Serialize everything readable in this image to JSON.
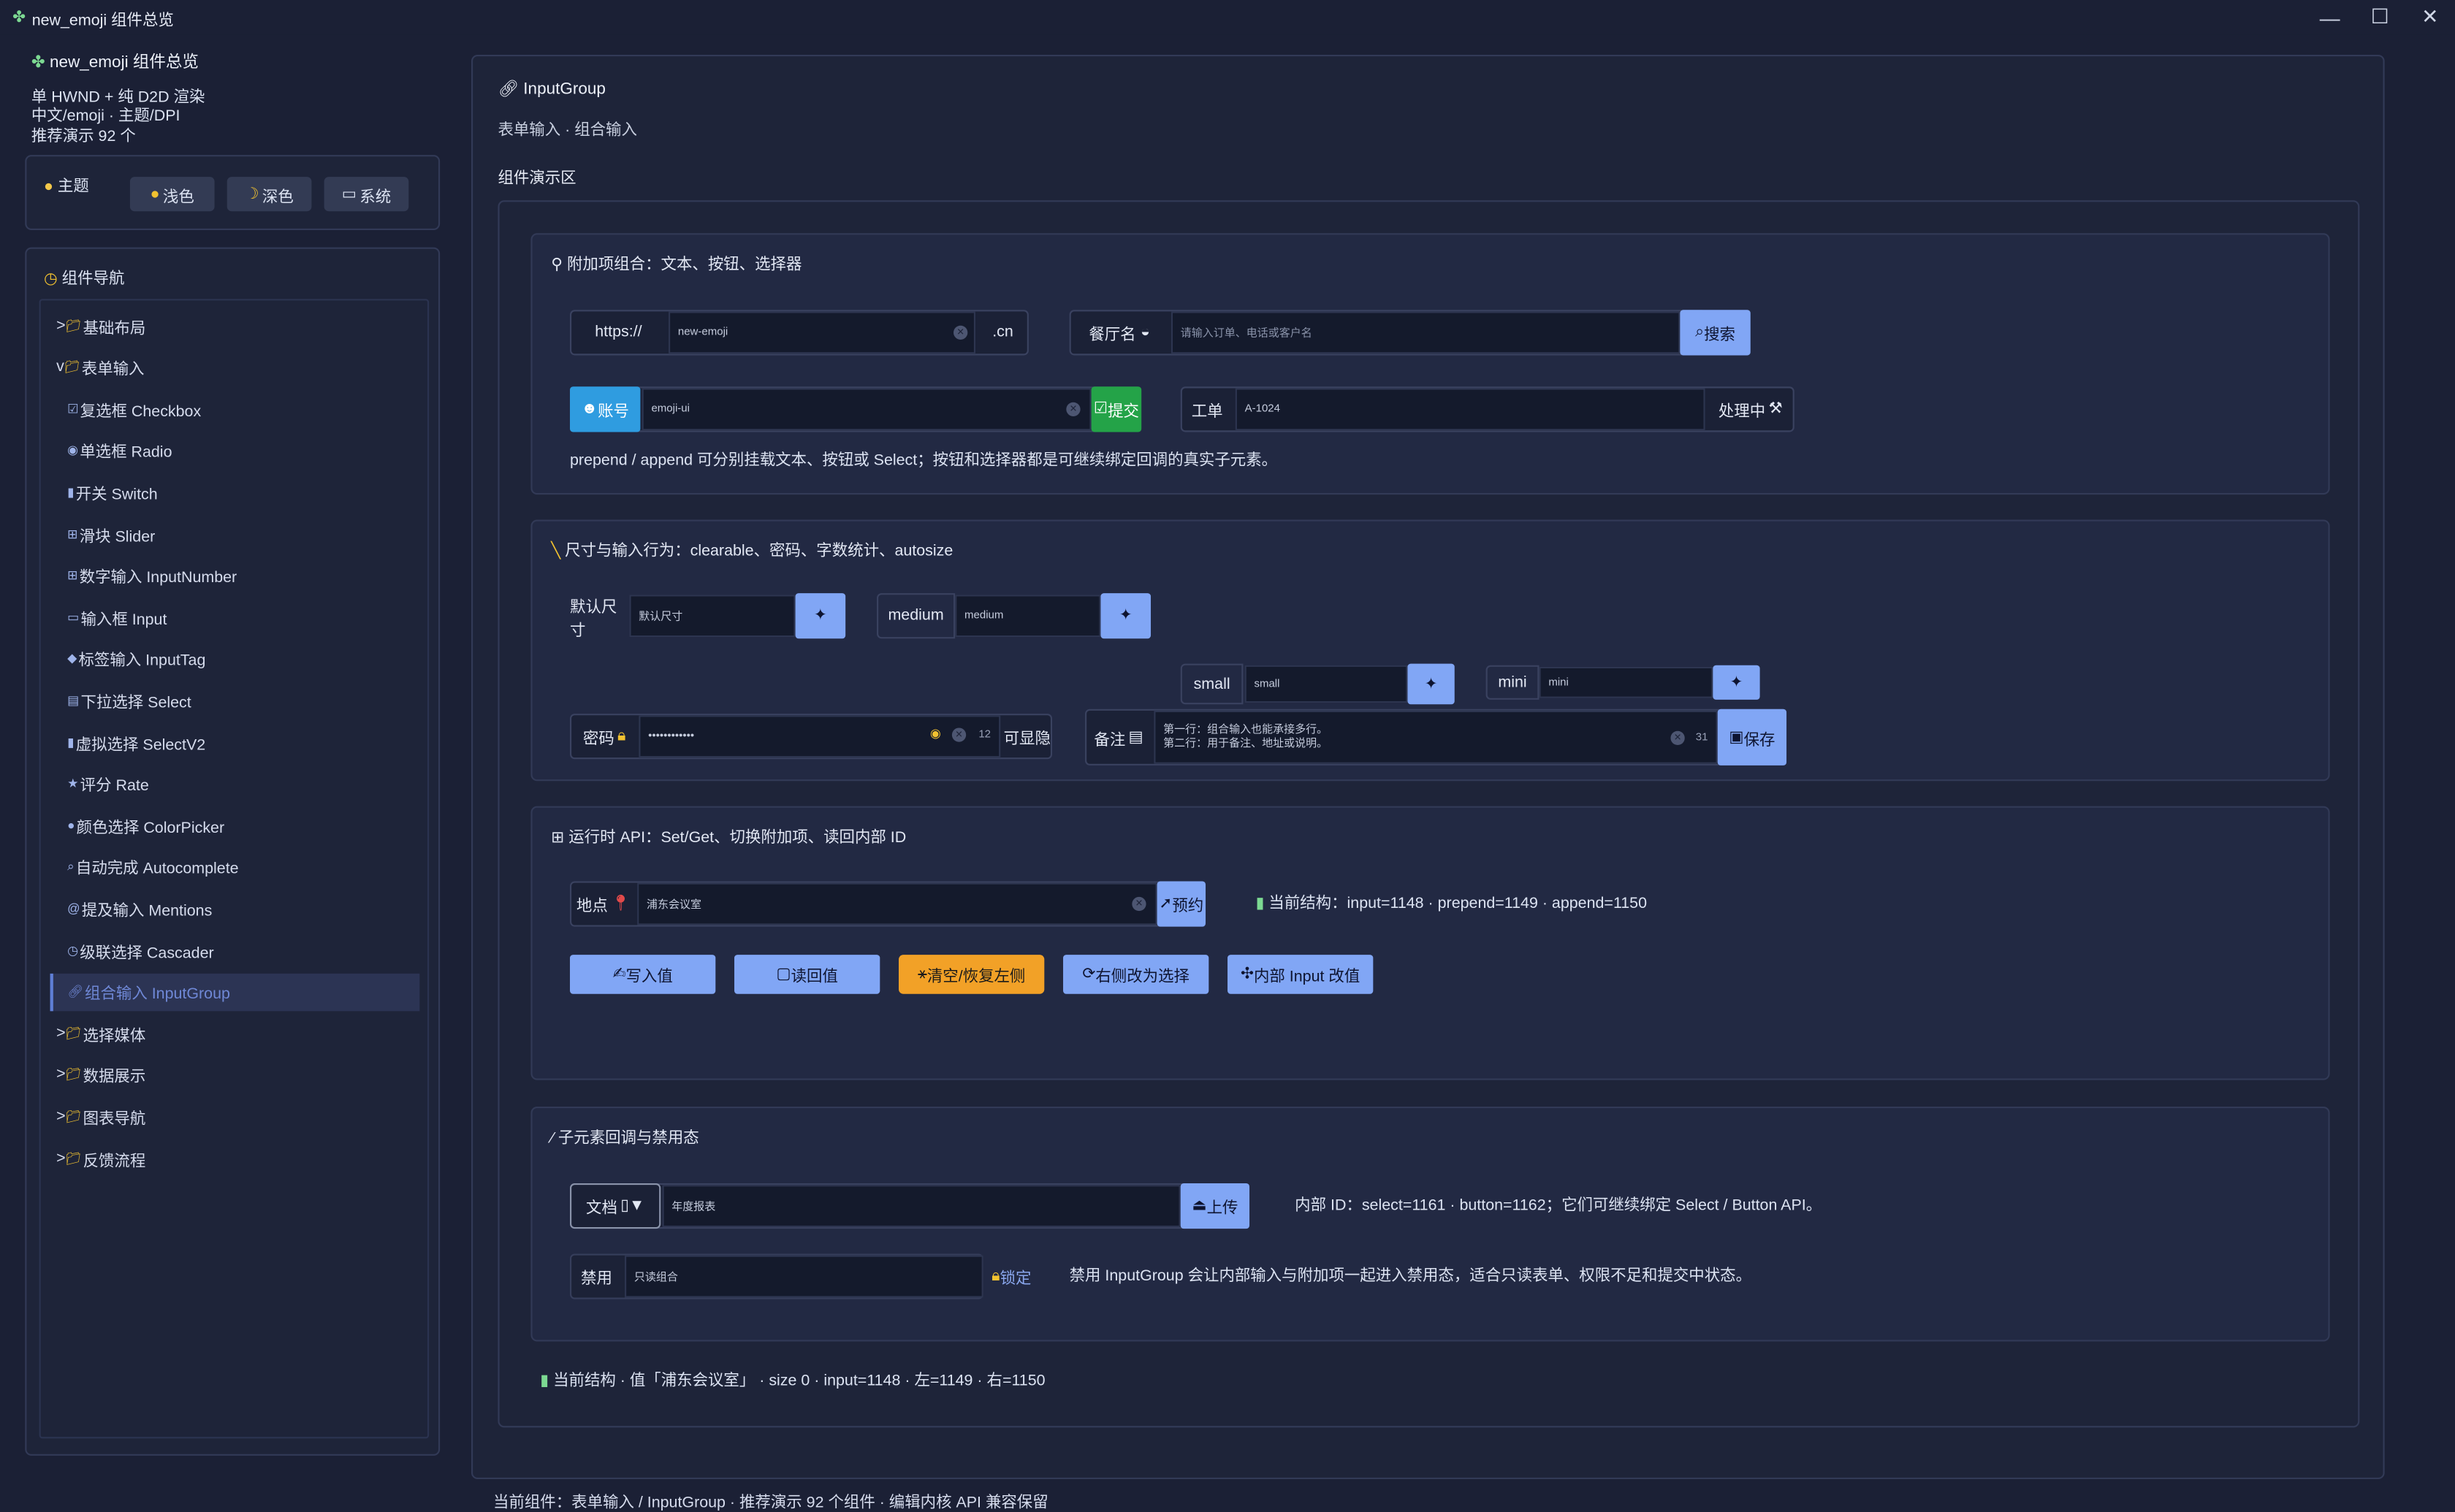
{
  "window": {
    "title": "new_emoji 组件总览",
    "icon": "✤",
    "min": "—",
    "max": "☐",
    "close": "✕"
  },
  "sidebar": {
    "title": "new_emoji 组件总览",
    "lines": [
      "单 HWND + 纯 D2D 渲染",
      "中文/emoji · 主题/DPI",
      "推荐演示 92 个"
    ],
    "theme": {
      "label": "主题",
      "buttons": [
        "浅色",
        "深色",
        "系统"
      ]
    },
    "nav": {
      "label": "组件导航",
      "items": [
        {
          "label": "基础布局",
          "prefix": ">"
        },
        {
          "label": "表单输入",
          "prefix": "v"
        },
        {
          "label": "复选框 Checkbox"
        },
        {
          "label": "单选框 Radio"
        },
        {
          "label": "开关 Switch"
        },
        {
          "label": "滑块 Slider"
        },
        {
          "label": "数字输入 InputNumber"
        },
        {
          "label": "输入框 Input"
        },
        {
          "label": "标签输入 InputTag"
        },
        {
          "label": "下拉选择 Select"
        },
        {
          "label": "虚拟选择 SelectV2"
        },
        {
          "label": "评分 Rate"
        },
        {
          "label": "颜色选择 ColorPicker"
        },
        {
          "label": "自动完成 Autocomplete"
        },
        {
          "label": "提及输入 Mentions"
        },
        {
          "label": "级联选择 Cascader"
        },
        {
          "label": "组合输入 InputGroup"
        },
        {
          "label": "选择媒体",
          "prefix": ">"
        },
        {
          "label": "数据展示",
          "prefix": ">"
        },
        {
          "label": "图表导航",
          "prefix": ">"
        },
        {
          "label": "反馈流程",
          "prefix": ">"
        }
      ]
    }
  },
  "main": {
    "title": "InputGroup",
    "subtitle": "表单输入 · 组合输入",
    "demo_label": "组件演示区",
    "card1": {
      "title": "附加项组合：文本、按钮、选择器",
      "prefix1": "https://",
      "value1": "new-emoji",
      "suffix1": ".cn",
      "prefix2": "餐厅名",
      "placeholder2": "请输入订单、电话或客户名",
      "btn2": "搜索",
      "prefix3": "账号",
      "value3": "emoji-ui",
      "btn3": "提交",
      "prefix4": "工单",
      "value4": "A-1024",
      "suffix4": "处理中",
      "desc": "prepend / append 可分别挂载文本、按钮或 Select；按钮和选择器都是可继续绑定回调的真实子元素。"
    },
    "card2": {
      "title": "尺寸与输入行为：clearable、密码、字数统计、autosize",
      "l_default": "默认尺寸",
      "v_default": "默认尺寸",
      "l_medium": "medium",
      "v_medium": "medium",
      "l_small": "small",
      "v_small": "small",
      "l_mini": "mini",
      "v_mini": "mini",
      "l_pwd": "密码",
      "v_pwd": "••••••••••••",
      "pwd_count": "12",
      "pwd_suffix": "可显隐",
      "l_note": "备注",
      "note_line1": "第一行：组合输入也能承接多行。",
      "note_line2": "第二行：用于备注、地址或说明。",
      "note_count": "31",
      "note_btn": "保存"
    },
    "card3": {
      "title": "运行时 API：Set/Get、切换附加项、读回内部 ID",
      "prefix": "地点",
      "value": "浦东会议室",
      "btn": "预约",
      "status": "当前结构：input=1148 · prepend=1149 · append=1150",
      "buttons": [
        "写入值",
        "读回值",
        "清空/恢复左侧",
        "右侧改为选择",
        "内部 Input 改值"
      ]
    },
    "card4": {
      "title": "子元素回调与禁用态",
      "prefix1": "文档",
      "value1": "年度报表",
      "btn1": "上传",
      "info1": "内部 ID：select=1161 · button=1162；它们可继续绑定 Select / Button API。",
      "prefix2": "禁用",
      "value2": "只读组合",
      "suffix2": "锁定",
      "info2": "禁用 InputGroup 会让内部输入与附加项一起进入禁用态，适合只读表单、权限不足和提交中状态。"
    },
    "status": "当前结构 · 值「浦东会议室」 · size 0 · input=1148 · 左=1149 · 右=1150"
  },
  "footer": "当前组件：表单输入 / InputGroup · 推荐演示 92 个组件 · 编辑内核 API 兼容保留",
  "colors": {
    "bg": "#1b2035",
    "accent": "#6e93e6",
    "active": "#2c3454",
    "green": "#24a348",
    "orange": "#f2a127"
  }
}
